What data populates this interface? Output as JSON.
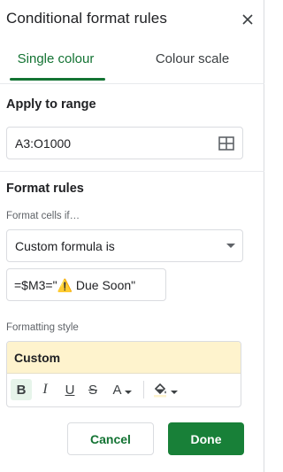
{
  "header": {
    "title": "Conditional format rules",
    "close_icon": "close-icon"
  },
  "tabs": [
    {
      "label": "Single colour",
      "active": true
    },
    {
      "label": "Colour scale",
      "active": false
    }
  ],
  "apply_to_range": {
    "label": "Apply to range",
    "value": "A3:O1000",
    "icon": "select-range-grid-icon"
  },
  "format_rules": {
    "label": "Format rules",
    "condition_label": "Format cells if…",
    "condition_value": "Custom formula is",
    "formula_prefix": "=$M3=\"",
    "formula_emoji": "⚠️",
    "formula_suffix": " Due Soon\""
  },
  "formatting_style": {
    "label": "Formatting style",
    "preset": "Custom",
    "preview_background": "#fef3cd",
    "toolbar": {
      "bold": "B",
      "italic": "I",
      "underline": "U",
      "strikethrough": "S",
      "text_color": "A",
      "fill_icon": "fill-color-icon"
    }
  },
  "actions": {
    "cancel": "Cancel",
    "done": "Done"
  },
  "colors": {
    "accent": "#137333",
    "done_bg": "#188038"
  }
}
